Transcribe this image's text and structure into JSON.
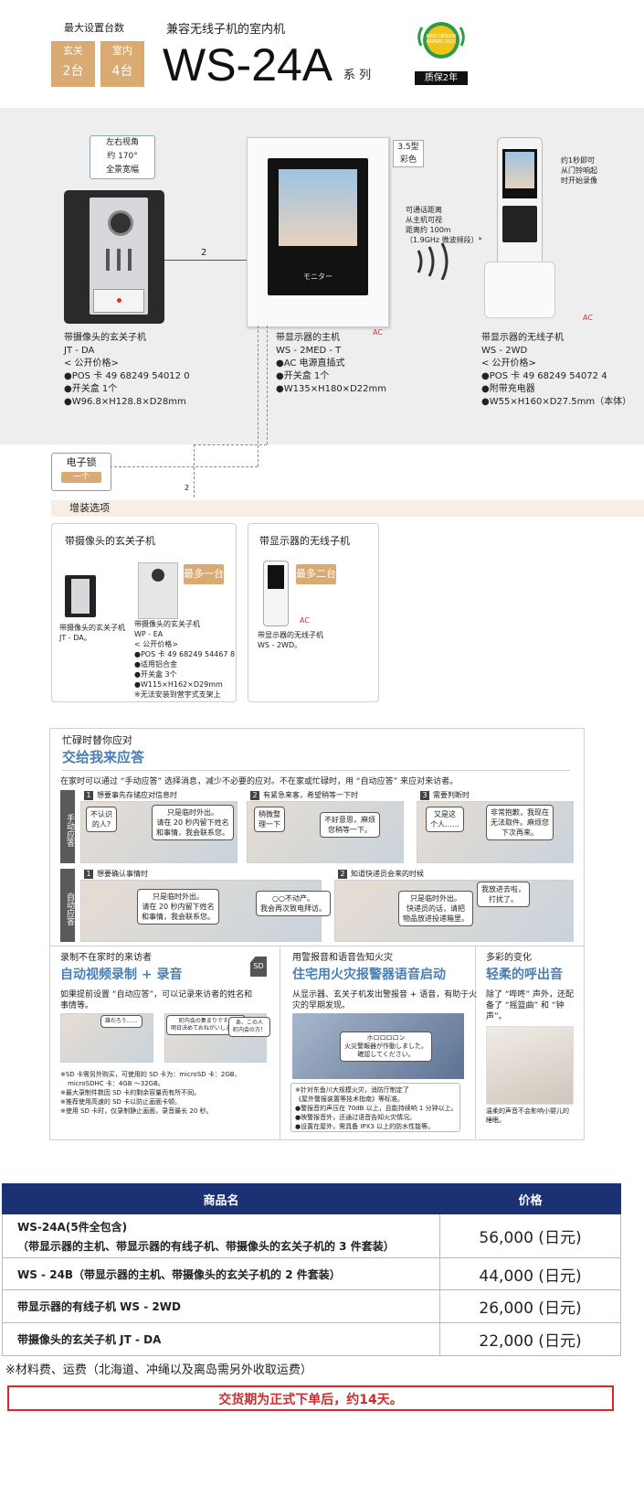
{
  "header": {
    "max_label": "最大设置台数",
    "entrance": {
      "title": "玄关",
      "count": "2台"
    },
    "indoor": {
      "title": "室内",
      "count": "4台"
    },
    "subtitle": "兼容无线子机的室内机",
    "model": "WS-24A",
    "series": "系 列",
    "award_text": "KIDS DESIGN AWARD 2021",
    "warranty": "质保2年"
  },
  "main_diagram": {
    "view_angle": [
      "左右视角",
      "约 170°",
      "全景宽幅"
    ],
    "screen_size": [
      "3.5型",
      "彩色"
    ],
    "range_note": [
      "可通话距离",
      "从主机可视",
      "距离约 100m",
      "（1.9GHz 微波频段）*"
    ],
    "auto_record": [
      "约1秒即可",
      "从门铃响起",
      "时开始录像"
    ],
    "wire_count_1": "2",
    "wire_count_2": "2",
    "ac_label": "AC",
    "ac_label_2": "AC",
    "monitor_label": "モニター",
    "door_station": [
      "带摄像头的玄关子机",
      "JT - DA",
      "< 公开价格>",
      "●POS 卡 49 68249 54012 0",
      "●开关盒 1个",
      "●W96.8×H128.8×D28mm"
    ],
    "master_unit": [
      "带显示器的主机",
      "WS - 2MED - T",
      "●AC 电源直插式",
      "●开关盒 1个",
      "●W135×H180×D22mm"
    ],
    "wireless_unit": [
      "带显示器的无线子机",
      "WS - 2WD",
      "< 公开价格>",
      "●POS 卡 49 68249 54072 4",
      "●附带充电器",
      "●W55×H160×D27.5mm（本体）"
    ],
    "electric_lock": {
      "title": "电子锁",
      "count": "一个"
    }
  },
  "addons": {
    "header": "增装选项",
    "card1": {
      "title": "带摄像头的玄关子机",
      "caption_a": [
        "带摄像头的玄关子机",
        "JT - DA。"
      ],
      "badge": "最多一台",
      "caption_b": [
        "带摄像头的玄关子机",
        "WP - EA",
        "< 公开价格>",
        "●POS 卡 49 68249 54467 8",
        "●适用铝合金",
        "●开关盒 3个",
        "●W115×H162×D29mm",
        "※无法安装到营宇式支架上"
      ]
    },
    "card2": {
      "title": "带显示器的无线子机",
      "badge": "最多二台",
      "caption": [
        "带显示器的无线子机",
        "WS - 2WD。"
      ]
    }
  },
  "feature1": {
    "small_title": "忙碌时替你应对",
    "title": "交给我来应答",
    "intro": "在家时可以通过 “手动应答” 选择消息，减少不必要的应对。不在家或忙碌时，用 “自动应答” 来应对来访者。",
    "manual_label": "手动应答",
    "auto_label": "自动应答",
    "manual_items": [
      {
        "num": "1",
        "title": "想要事先存储应对信息时",
        "bubbles": [
          "不认识\n的人?",
          "只是临时外出。\n请在 20 秒内留下姓名\n和事情，我会联系您。"
        ]
      },
      {
        "num": "2",
        "title": "有紧急来客，希望稍等一下时",
        "bubbles": [
          "稍微整\n理一下",
          "不好意思，麻烦\n您稍等一下。"
        ]
      },
      {
        "num": "3",
        "title": "需要判断时",
        "bubbles": [
          "又是这\n个人……",
          "非常抱歉，我现在\n无法取件。麻烦您\n下次再来。"
        ]
      }
    ],
    "auto_items": [
      {
        "num": "1",
        "title": "想要确认事情时",
        "bubbles": [
          "只是临时外出。\n请在 20 秒内留下姓名\n和事情，我会联系您。",
          "○○不动产。\n我会再次致电拜访。"
        ]
      },
      {
        "num": "2",
        "title": "知道快递员会来的时候",
        "bubbles": [
          "只是临时外出。\n快递员的话，请把\n物品放进投递箱里。",
          "我放进去啦，\n打扰了。"
        ]
      }
    ]
  },
  "features_row": [
    {
      "small": "录制不在家时的来访者",
      "title": "自动视频录制 + 录音",
      "sd": "SD",
      "body": [
        "如果提前设置 “自动应答”，可以记录来访者的姓名和",
        "事情等。"
      ],
      "bubbles": [
        "誰だろう……",
        "町内会の集まりです。\n明日決めておねがいします。",
        "あ、この人\n町内会の方！"
      ],
      "notes": [
        "※SD 卡需另外购买，可使用的 SD 卡为：microSD 卡：2GB、",
        "microSDHC 卡：4GB ～32GB。",
        "※最大录制件数因 SD 卡的剩余容量而有所不同。",
        "※推荐使用高速的 SD 卡以防止画面卡顿。",
        "※使用 SD 卡时，仅录制静止画面，录音最长 20 秒。"
      ]
    },
    {
      "small": "用警报音和语音告知火灾",
      "title": "住宅用火灾报警器语音启动",
      "body": [
        "从显示器、玄关子机发出警报音 + 语音，有助于火",
        "灾的早期发现。"
      ],
      "bubble": "ホロロロロン\n火災警報器が作動しました。\n確認してください。",
      "notes": [
        "※针对东鱼川大规模火灾，消防厅制定了",
        "《屋外警报装置等技术指南》等标准。",
        "●警报音的声压在 70dB 以上，且能持续响 1 分钟以上。",
        "●映警报音外，还通过语音告知火灾情况。",
        "●设置在屋外，需具备 IPX3 以上的防水性能等。"
      ]
    },
    {
      "small": "多彩的变化",
      "title": "轻柔的呼出音",
      "body": [
        "除了 “哔咚” 声外，还配",
        "备了 “摇篮曲” 和 “钟",
        "声”。"
      ],
      "caption": [
        "温柔的声音不会影响小婴儿的",
        "睡眠。"
      ]
    }
  ],
  "price_table": {
    "headers": [
      "商品名",
      "价格"
    ],
    "rows": [
      {
        "name_lines": [
          "WS-24A(5件全包含)",
          "（带显示器的主机、带显示器的有线子机、带摄像头的玄关子机的 3 件套装）"
        ],
        "price": "56,000 (日元)"
      },
      {
        "name_lines": [
          "WS - 24B（带显示器的主机、带摄像头的玄关子机的 2 件套装）"
        ],
        "price": "44,000 (日元)"
      },
      {
        "name_lines": [
          "带显示器的有线子机 WS - 2WD"
        ],
        "price": "26,000 (日元)"
      },
      {
        "name_lines": [
          "带摄像头的玄关子机 JT - DA"
        ],
        "price": "22,000 (日元)"
      }
    ]
  },
  "footer": {
    "note": "※材料费、运费（北海道、冲绳以及离岛需另外收取运费）",
    "delivery": "交货期为正式下单后，约14天。"
  },
  "colors": {
    "accent_orange": "#d9aa72",
    "title_blue": "#4a7fb5",
    "table_navy": "#1a3174",
    "delivery_red": "#d22b2b"
  }
}
